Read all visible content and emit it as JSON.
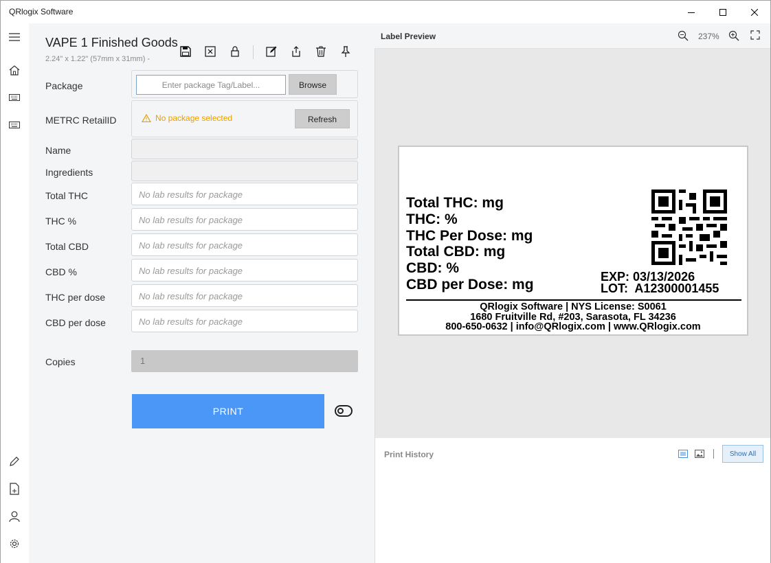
{
  "window": {
    "title": "QRlogix Software"
  },
  "document": {
    "title": "VAPE 1 Finished Goods",
    "subtitle": "2.24\" x 1.22\" (57mm x 31mm) -"
  },
  "form": {
    "package": {
      "label": "Package",
      "placeholder": "Enter package Tag/Label...",
      "browse_label": "Browse"
    },
    "metrc": {
      "label": "METRC RetailID",
      "warning": "No package selected",
      "refresh_label": "Refresh"
    },
    "name": {
      "label": "Name"
    },
    "ingredients": {
      "label": "Ingredients"
    },
    "lab_fields": [
      {
        "label": "Total THC",
        "value": "No lab results for package"
      },
      {
        "label": "THC %",
        "value": "No lab results for package"
      },
      {
        "label": "Total CBD",
        "value": "No lab results for package"
      },
      {
        "label": "CBD %",
        "value": "No lab results for package"
      },
      {
        "label": "THC per dose",
        "value": "No lab results for package"
      },
      {
        "label": "CBD per dose",
        "value": "No lab results for package"
      }
    ],
    "copies": {
      "label": "Copies",
      "value": "1"
    },
    "print_label": "PRINT"
  },
  "preview": {
    "title": "Label Preview",
    "zoom": "237%",
    "label": {
      "lines": [
        "Total THC: mg",
        "THC: %",
        "THC Per Dose: mg",
        "Total CBD: mg",
        "CBD: %",
        "CBD per Dose: mg"
      ],
      "exp": "EXP: 03/13/2026",
      "lot": "LOT:  A12300001455",
      "footer": [
        "QRlogix Software | NYS License: S0061",
        "1680 Fruitville Rd, #203, Sarasota, FL 34236",
        "800-650-0632 | info@QRlogix.com | www.QRlogix.com"
      ]
    }
  },
  "history": {
    "title": "Print History",
    "show_all_label": "Show All"
  },
  "colors": {
    "accent": "#4b97f7",
    "warning": "#e8a000",
    "panel": "#f4f5f7"
  }
}
